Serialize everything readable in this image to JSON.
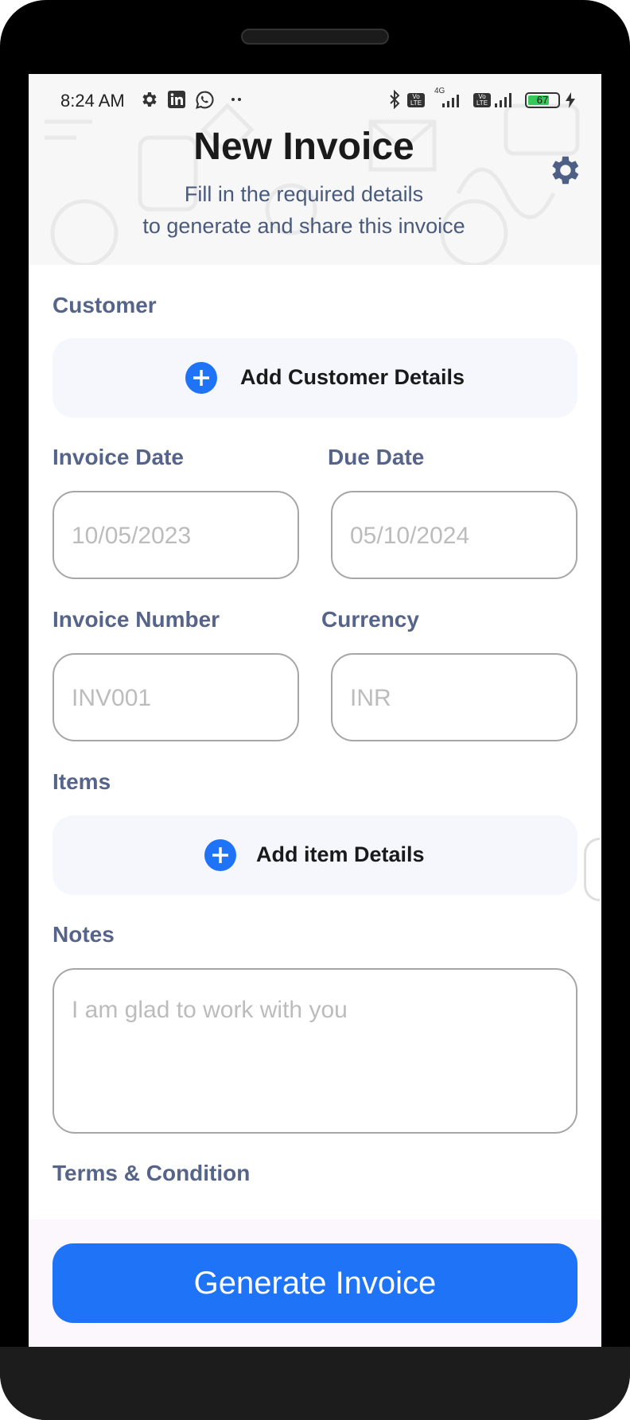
{
  "status_bar": {
    "time": "8:24 AM",
    "left_icons": [
      "gear-icon",
      "linkedin-icon",
      "whatsapp-icon",
      "more-dots-icon"
    ],
    "right_icons": [
      "bluetooth-icon",
      "volte-icon",
      "signal-4g-icon",
      "volte-icon",
      "signal-icon",
      "battery-icon",
      "charging-icon"
    ],
    "network_label": "4G",
    "volte_label": "Vo LTE",
    "battery_level": "67"
  },
  "header": {
    "title": "New Invoice",
    "subtitle_line1": "Fill in the required details",
    "subtitle_line2": "to generate and share this invoice",
    "settings_icon": "gear-icon"
  },
  "form": {
    "customer": {
      "label": "Customer",
      "add_label": "Add Customer Details"
    },
    "invoice_date": {
      "label": "Invoice Date",
      "placeholder": "10/05/2023"
    },
    "due_date": {
      "label": "Due Date",
      "placeholder": "05/10/2024"
    },
    "invoice_number": {
      "label": "Invoice Number",
      "placeholder": "INV001"
    },
    "currency": {
      "label": "Currency",
      "placeholder": "INR"
    },
    "items": {
      "label": "Items",
      "add_label": "Add item Details"
    },
    "notes": {
      "label": "Notes",
      "placeholder": "I am glad to work with you"
    },
    "terms": {
      "label": "Terms & Condition"
    }
  },
  "footer": {
    "generate_label": "Generate Invoice"
  },
  "colors": {
    "accent": "#1e73f6",
    "label": "#56648a",
    "subtitle": "#4a5a7c",
    "border": "#a6a6a6",
    "placeholder": "#bcbcbc",
    "add_box_bg": "#f5f7fc",
    "footer_bg": "#fcf7fd"
  }
}
